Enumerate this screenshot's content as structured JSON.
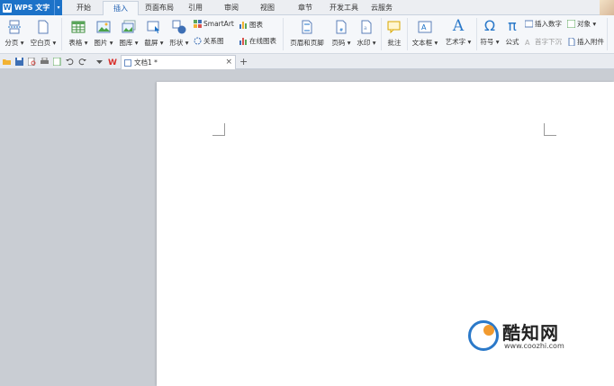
{
  "app": {
    "name": "WPS 文字",
    "logo_letter": "W",
    "dropdown_glyph": "▾"
  },
  "menu_tabs": [
    "开始",
    "插入",
    "页面布局",
    "引用",
    "审阅",
    "视图",
    "章节",
    "开发工具",
    "云服务"
  ],
  "active_tab": "插入",
  "ribbon": {
    "page_break": "分页 ▾",
    "blank_page": "空白页 ▾",
    "table": "表格 ▾",
    "picture": "图片 ▾",
    "gallery": "图库 ▾",
    "screenshot": "截屏 ▾",
    "shapes": "形状 ▾",
    "smartart": "SmartArt",
    "chart": "图表",
    "relation_chart": "关系图",
    "online_chart": "在线图表",
    "header_footer": "页眉和页脚",
    "page_number": "页码 ▾",
    "watermark": "水印 ▾",
    "comment": "批注",
    "textbox": "文本框 ▾",
    "wordart": "艺术字 ▾",
    "symbol": "符号 ▾",
    "formula": "公式",
    "insert_number": "插入数字",
    "object": "对象 ▾",
    "drop_cap": "首字下沉",
    "attachment": "插入附件",
    "omega_glyph": "Ω",
    "pi_glyph": "π",
    "wordart_glyph": "A"
  },
  "doc_tab": {
    "title": "文档1 *",
    "close": "×",
    "add": "+"
  },
  "quick_access": [
    "open-icon",
    "save-icon",
    "print-preview-icon",
    "print-icon",
    "export-icon",
    "undo-icon",
    "redo-icon",
    "customize-icon",
    "wps-logo-icon"
  ],
  "watermark": {
    "name": "酷知网",
    "url": "www.coozhi.com"
  },
  "colors": {
    "accent": "#1c72c8",
    "workspace": "#c9cdd3",
    "page": "#ffffff"
  }
}
